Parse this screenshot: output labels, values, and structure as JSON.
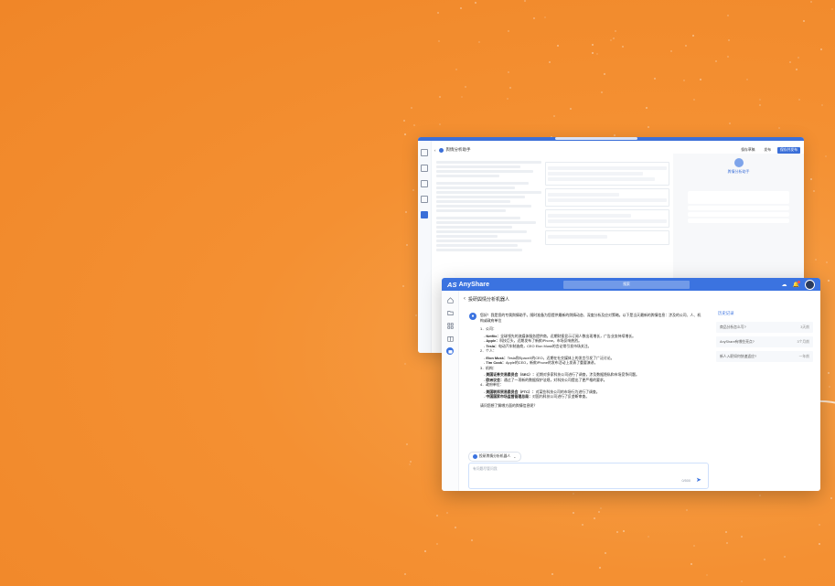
{
  "back_window": {
    "title": "舆情分析助手",
    "buttons": [
      "保存草稿",
      "发布",
      "保存并发布"
    ],
    "assistant_name": "舆情分析助手"
  },
  "app": {
    "logo": "AnyShare",
    "search_label": "搜索",
    "brand_color": "#3b73e0"
  },
  "breadcrumb": {
    "back_icon": "chevron-left-icon",
    "title": "投研舆情分析机器人"
  },
  "chat": {
    "intro": "您好！我是您的专属舆情助手。随时准备为您提供最新的舆情动态、深度分析及应对策略。以下是当天最新的舆情信息：涉及的公司、人、机构或政府单位",
    "s1": "1．公司：",
    "s1_items": [
      {
        "name": "Netflix：",
        "text": "全球领先的流媒体服务提供商，近期财报显示订阅人数出现增长，广告业务持续增长。"
      },
      {
        "name": "Apple：",
        "text": "科技巨头，近期发布了新款iPhone，市场反响热烈。"
      },
      {
        "name": "Tesla：",
        "text": "电动汽车制造商，CEO Elon Musk的言论常引发市场关注。"
      }
    ],
    "s2": "2．个人：",
    "s2_items": [
      {
        "name": "Elon Musk：",
        "text": "Tesla和SpaceX的CEO，近期在社交媒体上的发言引发了广泛讨论。"
      },
      {
        "name": "Tim Cook：",
        "text": "Apple的CEO，新款iPhone的发布活动上发表了重要演讲。"
      }
    ],
    "s3": "3．机构：",
    "s3_items": [
      {
        "name": "美国证券交易委员会（SEC）：",
        "text": "近期对多家科技公司进行了调查，涉及数据隐私和市场竞争问题。"
      },
      {
        "name": "欧洲议会：",
        "text": "通过了一项新的数据保护法规，对科技公司提出了更严格的要求。"
      }
    ],
    "s4": "4．政府单位：",
    "s4_items": [
      {
        "name": "美国联邦贸易委员会（FTC）：",
        "text": "对某些科技公司的市场行为进行了调查。"
      },
      {
        "name": "中国国家市场监督管理总局：",
        "text": "对国内科技公司进行了反垄断审查。"
      }
    ],
    "outro": "请问您想了解哪方面的舆情信息呢？"
  },
  "agent_selector": {
    "label": "投研舆情分析机器人"
  },
  "input": {
    "placeholder": "有问题尽管问我",
    "counter": "0/500"
  },
  "history": {
    "title": "历史记录",
    "items": [
      {
        "label": "商品分析怎么写?",
        "time": "3天前"
      },
      {
        "label": "AnyShare有哪些亮点?",
        "time": "3个月前"
      },
      {
        "label": "新人入职如何快速适应?",
        "time": "一年前"
      }
    ]
  }
}
